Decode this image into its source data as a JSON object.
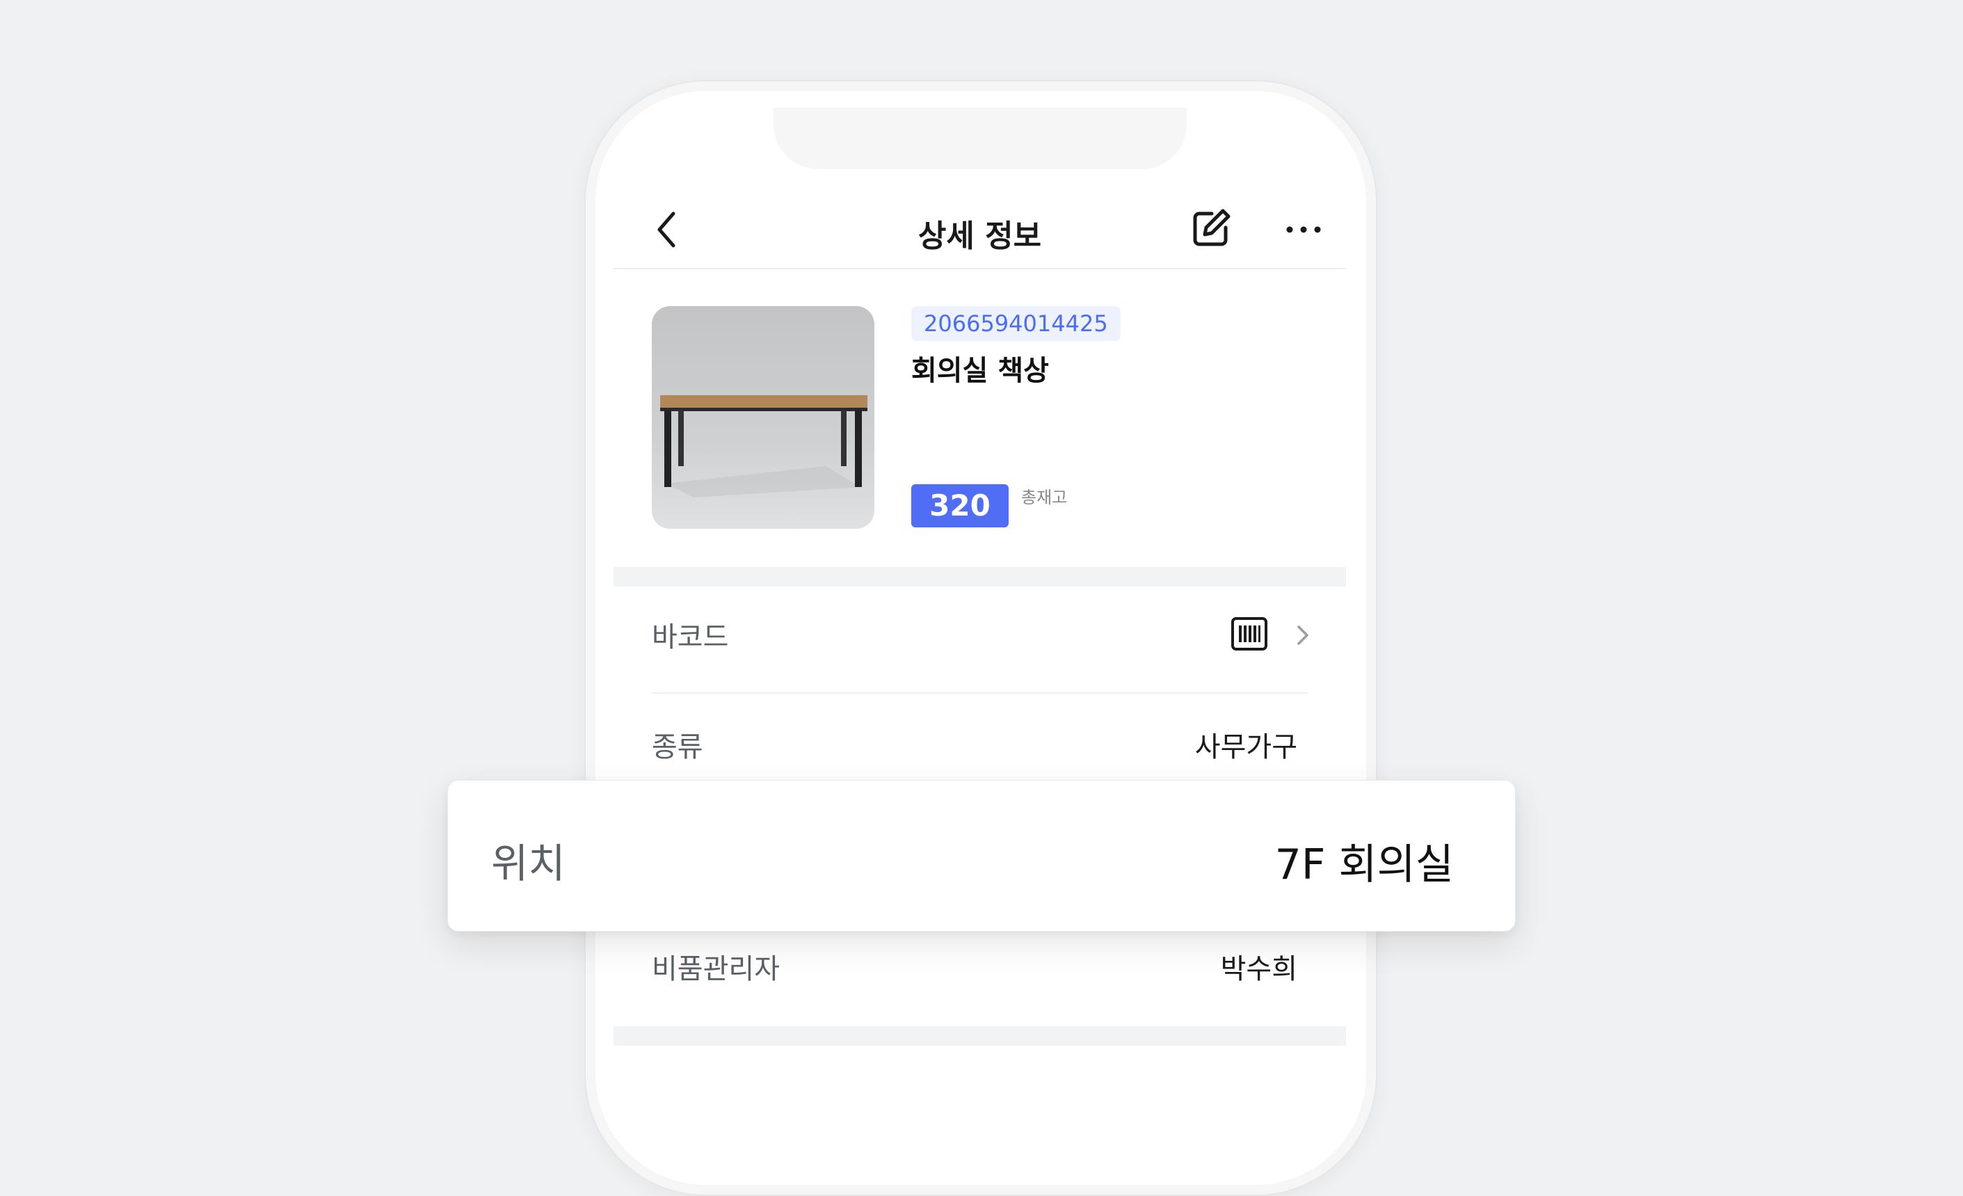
{
  "header": {
    "title": "상세 정보"
  },
  "product": {
    "code": "2066594014425",
    "name": "회의실 책상",
    "stock": "320",
    "stock_label": "총재고"
  },
  "details": {
    "barcode_label": "바코드",
    "type_label": "종류",
    "type_value": "사무가구",
    "manager_label": "비품관리자",
    "manager_value": "박수희"
  },
  "location": {
    "label": "위치",
    "value": "7F 회의실"
  },
  "icons": {
    "back": "chevron-left-icon",
    "edit": "edit-icon",
    "more": "more-horizontal-icon",
    "barcode": "barcode-icon",
    "chevron": "chevron-right-icon"
  },
  "colors": {
    "accent": "#4f6df5",
    "code_badge_text": "#4a6cf7",
    "code_badge_bg": "#eef2ff",
    "background": "#f0f1f3"
  }
}
